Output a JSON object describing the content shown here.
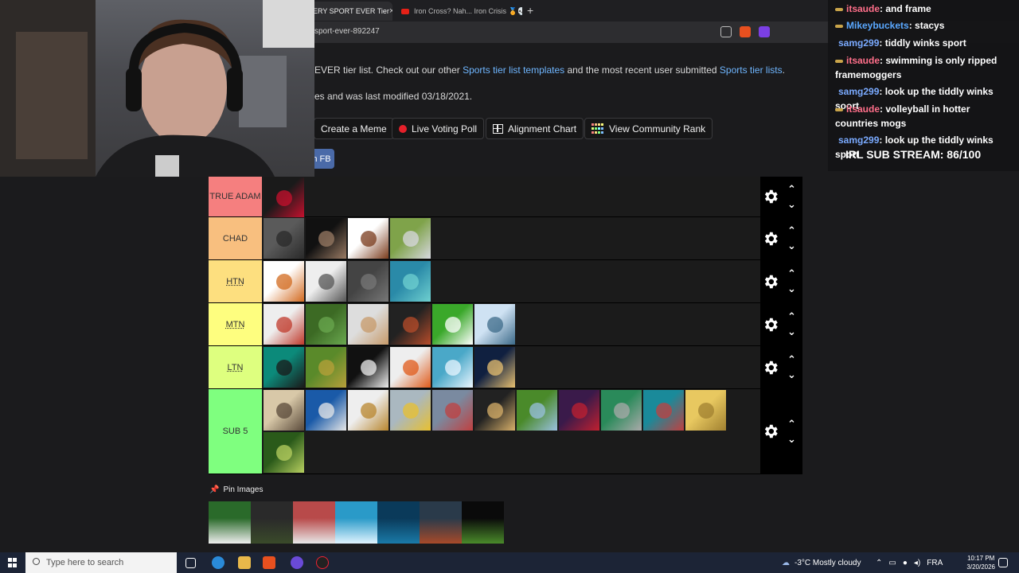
{
  "browser": {
    "tabs": [
      {
        "title": "ERY SPORT EVER Tier",
        "close": "×"
      },
      {
        "title": "Iron Cross? Nah... Iron Crisis 🏅💀 #"
      }
    ],
    "new_tab": "+",
    "url": "sport-ever-892247"
  },
  "page": {
    "intro_prefix": "EVER tier list. Check out our other ",
    "intro_link1": "Sports tier list templates",
    "intro_middle": " and the most recent user submitted ",
    "intro_link2": "Sports tier lists",
    "intro_suffix": ".",
    "modified_text": "es and was last modified 03/18/2021.",
    "buttons": {
      "meme": "Create a Meme",
      "poll": "Live Voting Poll",
      "alignment": "Alignment Chart",
      "community": "View Community Rank",
      "fb": "n FB"
    }
  },
  "tiers": [
    {
      "label": "TRUE ADAM",
      "color": "#f57f7f",
      "dotted": false,
      "tiles": [
        [
          "#1a1a1a",
          "#c8102e"
        ]
      ]
    },
    {
      "label": "CHAD",
      "color": "#f8bf7f",
      "dotted": false,
      "tiles": [
        [
          "#5a5a5a",
          "#2a2a2a"
        ],
        [
          "#111",
          "#9a7b64"
        ],
        [
          "#fff",
          "#7a3b1c"
        ],
        [
          "#7fa34a",
          "#d8d8e0"
        ]
      ]
    },
    {
      "label": "HTN",
      "color": "#fddf7f",
      "dotted": true,
      "tiles": [
        [
          "#fff",
          "#d2691e"
        ],
        [
          "#eee",
          "#555"
        ],
        [
          "#444",
          "#777"
        ],
        [
          "#2a8aa8",
          "#6fd0d0"
        ]
      ]
    },
    {
      "label": "MTN",
      "color": "#fefe7f",
      "dotted": true,
      "tiles": [
        [
          "#eee",
          "#c0392b"
        ],
        [
          "#3c6a24",
          "#6aa84f"
        ],
        [
          "#ddd",
          "#c79a6a"
        ],
        [
          "#222",
          "#b84c2a"
        ],
        [
          "#3aa82a",
          "#fff"
        ],
        [
          "#cfe2f3",
          "#3d6b8a"
        ]
      ]
    },
    {
      "label": "LTN",
      "color": "#deff7f",
      "dotted": true,
      "tiles": [
        [
          "#0c8a7a",
          "#1a1a1a"
        ],
        [
          "#5a8a2a",
          "#b8a03a"
        ],
        [
          "#111",
          "#eee"
        ],
        [
          "#eee",
          "#e05a1a"
        ],
        [
          "#4aa8c8",
          "#eaf6ff"
        ],
        [
          "#102040",
          "#e8c070"
        ]
      ]
    },
    {
      "label": "SUB 5",
      "color": "#7fff7f",
      "dotted": false,
      "tiles": [
        [
          "#d8c8a8",
          "#5a4a3a"
        ],
        [
          "#1a5aa8",
          "#e8e8e8"
        ],
        [
          "#eee",
          "#b8862e"
        ],
        [
          "#aab8c0",
          "#e8c030"
        ],
        [
          "#7a8aa0",
          "#c04040"
        ],
        [
          "#222",
          "#d8b06a"
        ],
        [
          "#4a8a2a",
          "#9ac0e0"
        ],
        [
          "#3a1a4a",
          "#c02030"
        ],
        [
          "#2a8a5a",
          "#aaa"
        ],
        [
          "#1a8a9a",
          "#c04040"
        ],
        [
          "#e8c860",
          "#a08030"
        ],
        [
          "#2a5a1a",
          "#b8d060"
        ]
      ]
    }
  ],
  "pin": {
    "label": "Pin Images",
    "icon": "pin-icon"
  },
  "bank_tiles": [
    [
      "#2a6a2a",
      "#eee"
    ],
    [
      "#2a2a2a",
      "#3a4a2a"
    ],
    [
      "#b84a4a",
      "#e8e8e8"
    ],
    [
      "#2a9ac8",
      "#e0f4ff"
    ],
    [
      "#0a3a5a",
      "#1a7aa8"
    ],
    [
      "#2a3a4a",
      "#a84a2a"
    ],
    [
      "#0a0a0a",
      "#4a8a2a"
    ]
  ],
  "chat": {
    "lines": [
      {
        "badge": true,
        "user": "itsaude",
        "color": "#ff6f8a",
        "text": ": and frame"
      },
      {
        "badge": true,
        "user": "Mikeybuckets",
        "color": "#5aa8ff",
        "text": ": stacys"
      },
      {
        "badge": false,
        "user": "samg299",
        "color": "#7aaaff",
        "text": ": tiddly winks sport"
      },
      {
        "badge": true,
        "user": "itsaude",
        "color": "#ff6f8a",
        "text": ": swimming is only ripped framemoggers"
      },
      {
        "badge": false,
        "user": "samg299",
        "color": "#7aaaff",
        "text": ": look up the tiddly winks soort"
      },
      {
        "badge": true,
        "user": "itsaude",
        "color": "#ff6f8a",
        "text": ": volleyball in hotter countries mogs"
      },
      {
        "badge": false,
        "user": "samg299",
        "color": "#7aaaff",
        "text": ": look up the tiddly winks sport"
      }
    ],
    "sub_stream": "IRL SUB STREAM: 86/100"
  },
  "taskbar": {
    "search_placeholder": "Type here to search",
    "weather": "-3°C  Mostly cloudy",
    "lang": "FRA",
    "time": "10:17 PM",
    "date": "3/20/2026"
  }
}
